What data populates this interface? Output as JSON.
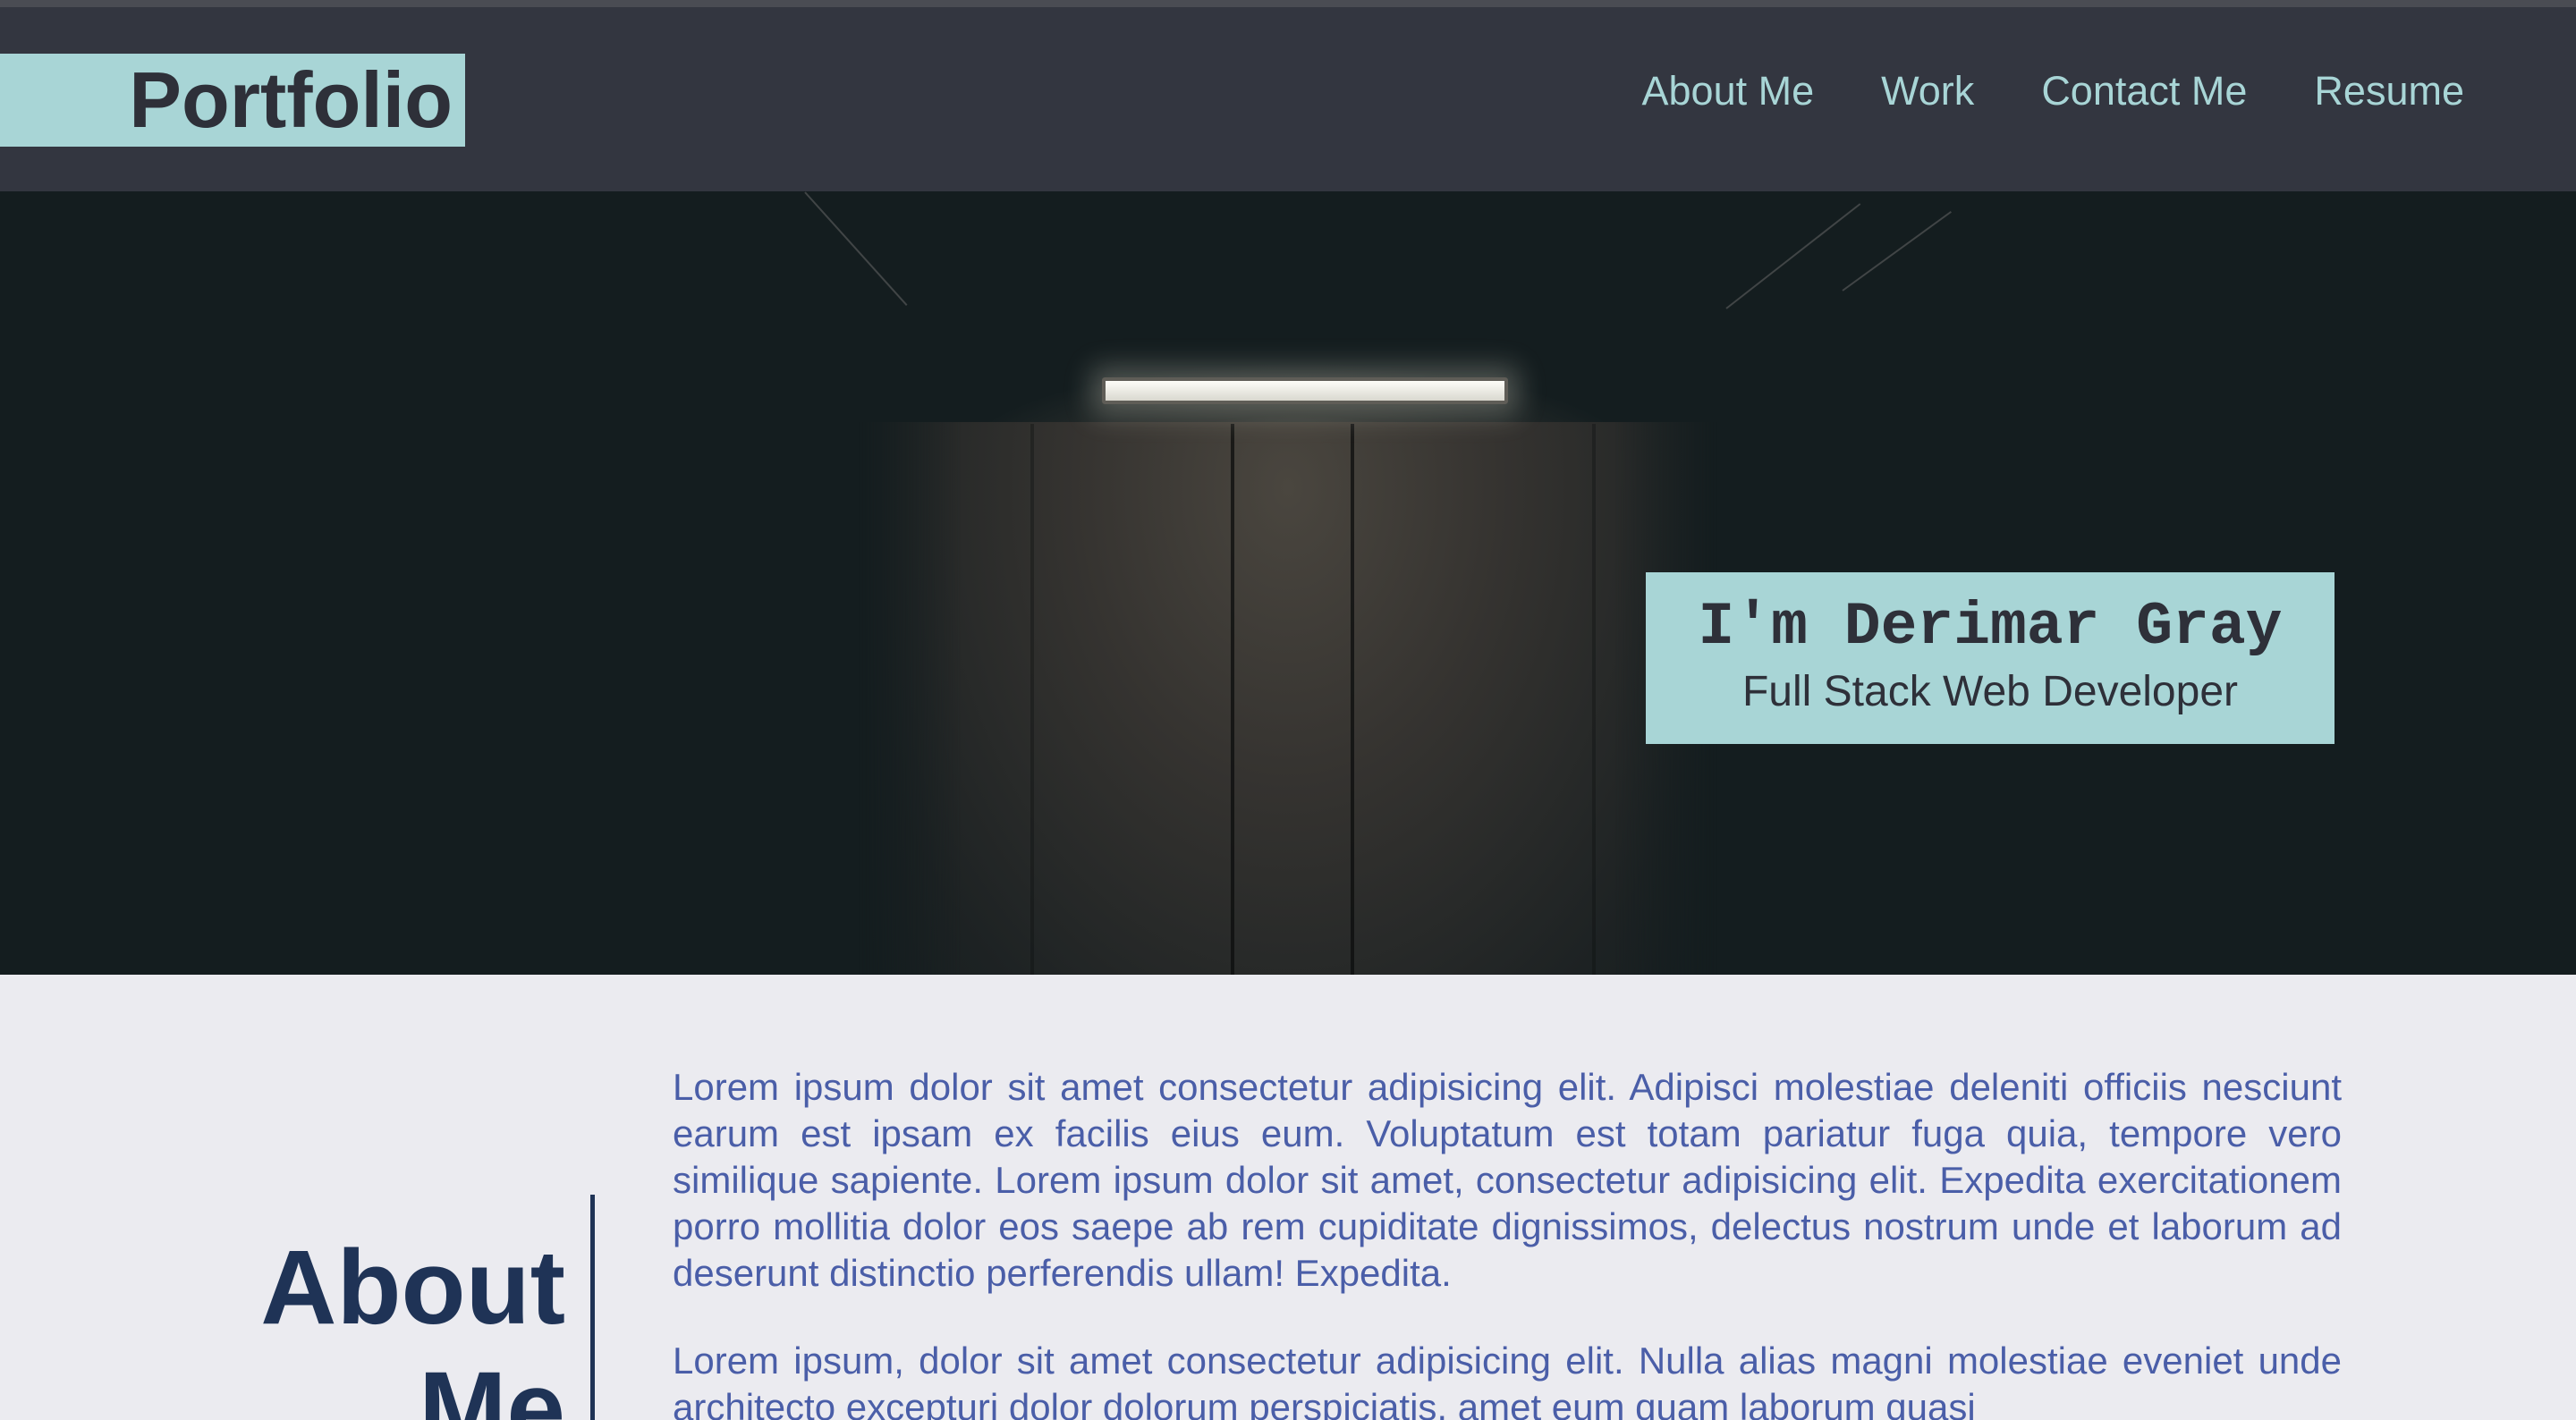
{
  "header": {
    "logo": "Portfolio",
    "nav": [
      {
        "label": "About Me"
      },
      {
        "label": "Work"
      },
      {
        "label": "Contact Me"
      },
      {
        "label": "Resume"
      }
    ]
  },
  "hero": {
    "name": "I'm Derimar Gray",
    "role": "Full Stack Web Developer"
  },
  "about": {
    "title": "About Me",
    "paragraphs": [
      "Lorem ipsum dolor sit amet consectetur adipisicing elit. Adipisci molestiae deleniti officiis nesciunt earum est ipsam ex facilis eius eum. Voluptatum est totam pariatur fuga quia, tempore vero similique sapiente. Lorem ipsum dolor sit amet, consectetur adipisicing elit. Expedita exercitationem porro mollitia dolor eos saepe ab rem cupiditate dignissimos, delectus nostrum unde et laborum ad deserunt distinctio perferendis ullam! Expedita.",
      "Lorem ipsum, dolor sit amet consectetur adipisicing elit. Nulla alias magni molestiae eveniet unde architecto excepturi dolor dolorum perspiciatis, amet eum quam laborum quasi"
    ]
  },
  "colors": {
    "header_bg": "#333640",
    "accent": "#a8d5d6",
    "hero_bg": "#141d1f",
    "about_bg": "#ebebf0",
    "heading": "#1f3356",
    "body_text": "#4a5ea8"
  }
}
